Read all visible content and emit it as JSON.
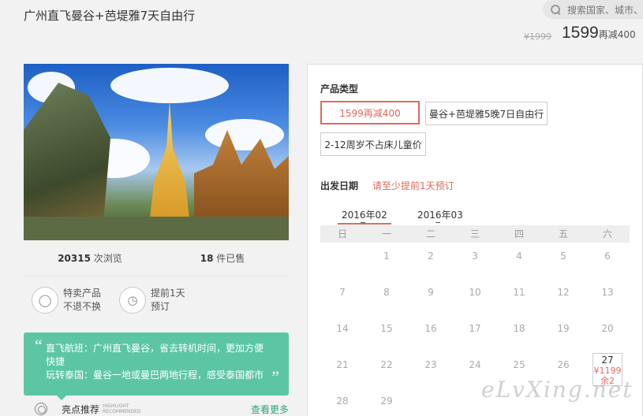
{
  "page": {
    "title": "广州直飞曼谷+芭堤雅7天自由行"
  },
  "search": {
    "placeholder": "搜索国家、城市、"
  },
  "price": {
    "original": "¥1999",
    "current": "1599",
    "promo_suffix": "再减400"
  },
  "stats": {
    "views_count": "20315",
    "views_label": "次浏览",
    "sold_count": "18",
    "sold_label": "件已售"
  },
  "features": [
    {
      "icon": "tag-icon",
      "line1": "特卖产品",
      "line2": "不退不换"
    },
    {
      "icon": "clock-icon",
      "line1": "提前1天",
      "line2": "预订"
    }
  ],
  "highlight": {
    "line1": "直飞航班：广州直飞曼谷，省去转机时间，更加方便快捷",
    "line2": "玩转泰国：曼谷一地或曼巴两地行程，感受泰国都市",
    "label": "亮点推荐",
    "label_en": "HIGHLIGHT RECOMMENDED",
    "more": "查看更多"
  },
  "product": {
    "section_label": "产品类型",
    "options": [
      "1599再减400",
      "曼谷+芭堤雅5晚7日自由行",
      "2-12周岁不占床儿童价"
    ]
  },
  "date": {
    "section_label": "出发日期",
    "hint": "请至少提前1天预订",
    "months": [
      "2016年02",
      "2016年03"
    ],
    "weekdays": [
      "日",
      "一",
      "二",
      "三",
      "四",
      "五",
      "六"
    ],
    "rows": [
      [
        "",
        "1",
        "2",
        "3",
        "4",
        "5",
        "6"
      ],
      [
        "7",
        "8",
        "9",
        "10",
        "11",
        "12",
        "13"
      ],
      [
        "14",
        "15",
        "16",
        "17",
        "18",
        "19",
        "20"
      ],
      [
        "21",
        "22",
        "23",
        "24",
        "25",
        "26",
        "27"
      ],
      [
        "28",
        "29",
        "",
        "",
        "",
        "",
        ""
      ]
    ],
    "available": {
      "day": "27",
      "price": "¥1199",
      "remaining": "余2"
    }
  },
  "watermark": "eLvXing.net",
  "colors": {
    "accent": "#e06a5a",
    "highlight_green": "#5cc6a4",
    "more_link": "#2ea37a"
  }
}
